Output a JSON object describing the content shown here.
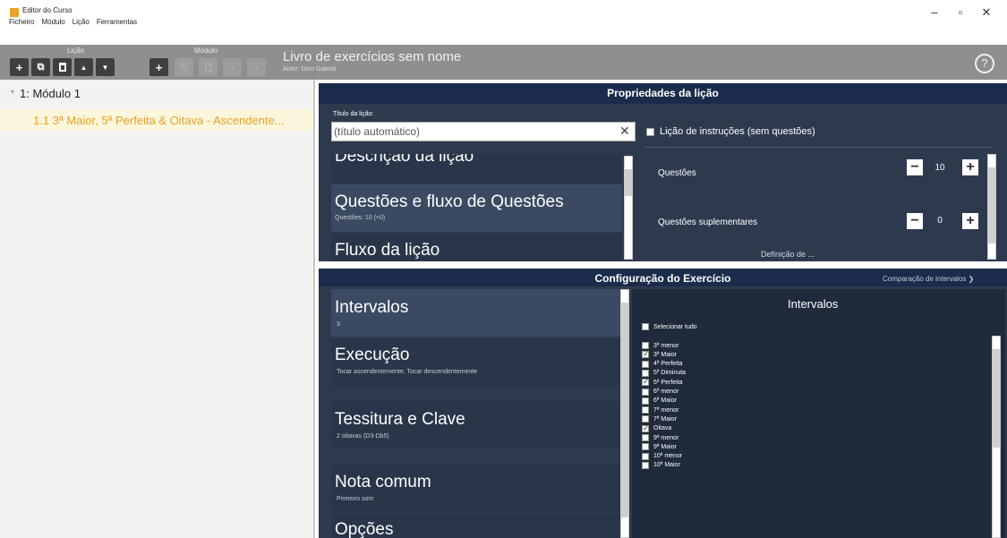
{
  "window": {
    "title": "Editor do Curso",
    "controls": {
      "minimize": "–",
      "maximize": "▫",
      "close": "✕"
    }
  },
  "menu": [
    "Ficheiro",
    "Módulo",
    "Lição",
    "Ferramentas"
  ],
  "toolbar": {
    "lesson_group": "Lição",
    "module_group": "Módulo",
    "book_title": "Livro de exercícios sem nome",
    "author": "Autor: Dino Gabriel",
    "help": "?",
    "icons": {
      "add": "+",
      "duplicate": "⧉",
      "delete": "🗑",
      "up": "▲",
      "down": "▼"
    }
  },
  "tree": {
    "module": "1: Módulo 1",
    "lesson": "1.1 3ª Maior, 5ª Perfeita & Oitava - Ascendente..."
  },
  "lesson_props": {
    "header": "Propriedades da lição",
    "title_label": "Título da lição:",
    "title_placeholder": "(título automático)",
    "clear": "✕",
    "instructions_label": "Lição de instruções (sem questões)",
    "tabs": [
      {
        "title": "Descrição da lição",
        "sub": ""
      },
      {
        "title": "Questões e fluxo de Questões",
        "sub": "Questões: 10 (+0)"
      },
      {
        "title": "Fluxo da lição",
        "sub": ""
      }
    ],
    "questions_label": "Questões",
    "questions_value": "10",
    "supp_label": "Questões suplementares",
    "supp_value": "0",
    "cut_label": "Definição de ...",
    "minus": "−",
    "plus": "+"
  },
  "exercise_config": {
    "header": "Configuração do Exercício",
    "type_select": "Comparação de intervalos ❯",
    "tabs": [
      {
        "title": "Intervalos",
        "sub": "3"
      },
      {
        "title": "Execução",
        "sub": "Tocar ascendentemente, Tocar descendentemente"
      },
      {
        "title": "Tessitura e Clave",
        "sub": "2 oitavas (D3-Db5)"
      },
      {
        "title": "Nota comum",
        "sub": "Primeiro som"
      },
      {
        "title": "Opções",
        "sub": ""
      }
    ],
    "intervals_title": "Intervalos",
    "select_all": "Selecionar tudo",
    "intervals": [
      {
        "label": "3ª menor",
        "checked": false
      },
      {
        "label": "3ª Maior",
        "checked": true
      },
      {
        "label": "4ª Perfeita",
        "checked": false
      },
      {
        "label": "5ª Diminuta",
        "checked": false
      },
      {
        "label": "5ª Perfeita",
        "checked": true
      },
      {
        "label": "6ª menor",
        "checked": false
      },
      {
        "label": "6ª Maior",
        "checked": false
      },
      {
        "label": "7ª menor",
        "checked": false
      },
      {
        "label": "7ª Maior",
        "checked": false
      },
      {
        "label": "Oitava",
        "checked": true
      },
      {
        "label": "9ª menor",
        "checked": false
      },
      {
        "label": "9ª Maior",
        "checked": false
      },
      {
        "label": "10ª menor",
        "checked": false
      },
      {
        "label": "10ª Maior",
        "checked": false
      }
    ]
  },
  "colors": {
    "accent": "#e8a227",
    "panel_header": "#1b2b4b",
    "panel_body": "#2d3a4e",
    "toolbar": "#8f8f8f"
  }
}
